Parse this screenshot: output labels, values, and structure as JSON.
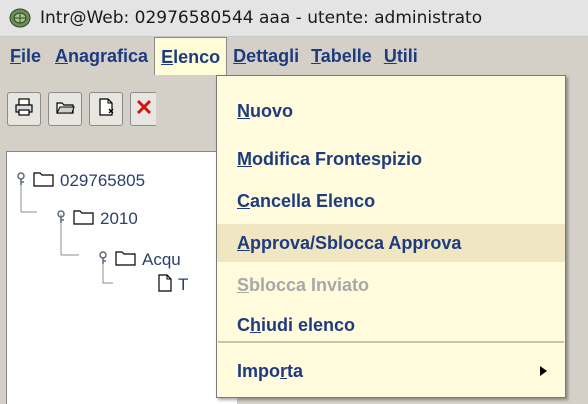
{
  "window": {
    "title": "Intr@Web: 02976580544  aaa - utente: administrato",
    "icon": "app-logo-icon"
  },
  "menubar": {
    "items": [
      {
        "prefix": "",
        "mnemonic": "F",
        "suffix": "ile",
        "active": false
      },
      {
        "prefix": "",
        "mnemonic": "A",
        "suffix": "nagrafica",
        "active": false
      },
      {
        "prefix": "",
        "mnemonic": "E",
        "suffix": "lenco",
        "active": true
      },
      {
        "prefix": "",
        "mnemonic": "D",
        "suffix": "ettagli",
        "active": false
      },
      {
        "prefix": "",
        "mnemonic": "T",
        "suffix": "abelle",
        "active": false
      },
      {
        "prefix": "",
        "mnemonic": "U",
        "suffix": "tili",
        "active": false
      }
    ]
  },
  "toolbar": {
    "icons": [
      "printer-icon",
      "open-folder-icon",
      "new-document-icon",
      "delete-icon"
    ]
  },
  "tree": {
    "nodes": [
      {
        "label": "029765805",
        "type": "folder"
      },
      {
        "label": "2010",
        "type": "folder"
      },
      {
        "label": "Acqu",
        "type": "folder"
      },
      {
        "label": "T",
        "type": "document"
      }
    ]
  },
  "dropdown": {
    "items": [
      {
        "prefix": "",
        "mnemonic": "N",
        "suffix": "uovo",
        "state": "normal"
      },
      {
        "prefix": "",
        "mnemonic": "M",
        "suffix": "odifica Frontespizio",
        "state": "normal"
      },
      {
        "prefix": "",
        "mnemonic": "C",
        "suffix": "ancella Elenco",
        "state": "normal"
      },
      {
        "prefix": "",
        "mnemonic": "A",
        "suffix": "pprova/Sblocca Approva",
        "state": "highlighted"
      },
      {
        "prefix": "",
        "mnemonic": "S",
        "suffix": "blocca Inviato",
        "state": "disabled"
      },
      {
        "prefix": "C",
        "mnemonic": "h",
        "suffix": "iudi elenco",
        "state": "normal"
      },
      {
        "prefix": "Impo",
        "mnemonic": "r",
        "suffix": "ta",
        "state": "submenu"
      }
    ]
  },
  "colors": {
    "menu_text": "#1d3b7f",
    "menu_background": "#fffbdc",
    "highlight": "#f1e6c2",
    "disabled_text": "#a8a8a8"
  }
}
